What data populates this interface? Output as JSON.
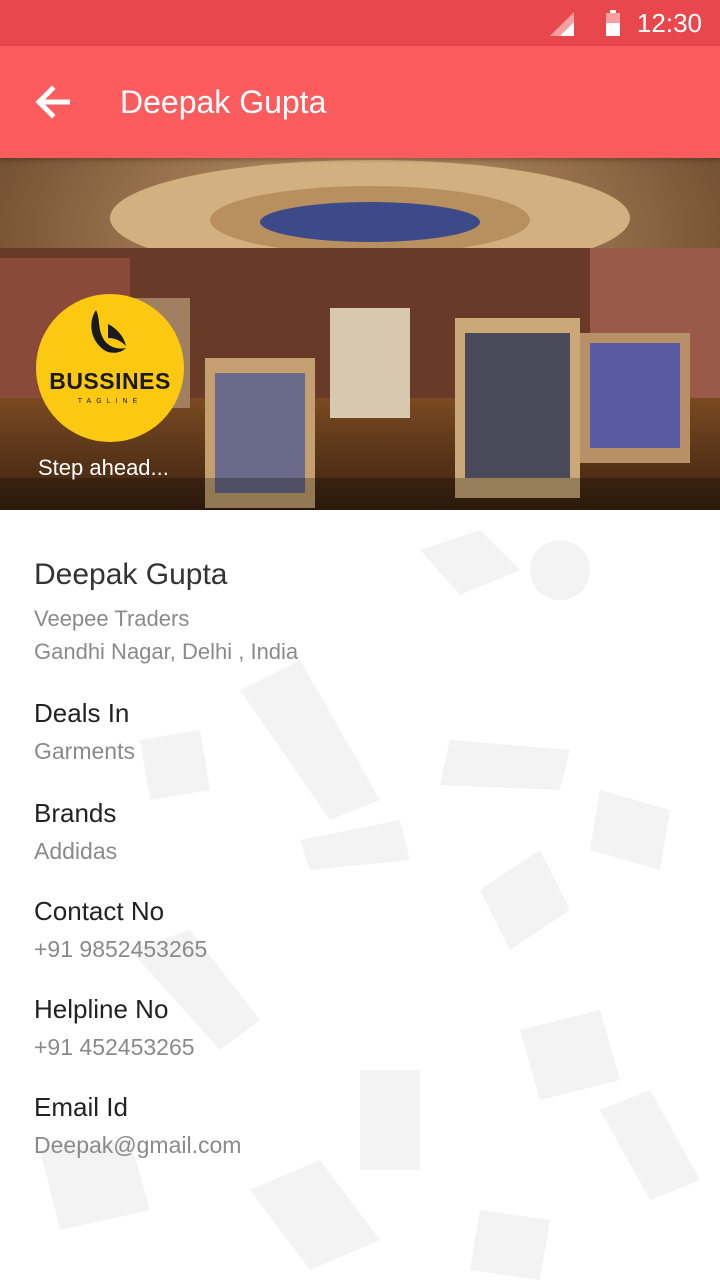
{
  "status_bar": {
    "time": "12:30",
    "signal_icon": "signal-icon",
    "battery_icon": "battery-icon"
  },
  "app_bar": {
    "title": "Deepak Gupta",
    "back_icon": "arrow-left-icon"
  },
  "hero": {
    "logo_text": "BUSSINES",
    "logo_tagline": "TAGLINE",
    "tagline": "Step ahead..."
  },
  "profile": {
    "name": "Deepak Gupta",
    "company": "Veepee Traders",
    "address": "Gandhi Nagar, Delhi , India",
    "fields": [
      {
        "label": "Deals In",
        "value": "Garments"
      },
      {
        "label": "Brands",
        "value": "Addidas"
      },
      {
        "label": "Contact No",
        "value": "+91 9852453265"
      },
      {
        "label": "Helpline No",
        "value": "+91 452453265"
      },
      {
        "label": "Email Id",
        "value": "Deepak@gmail.com"
      }
    ]
  },
  "colors": {
    "status_bar": "#e8474c",
    "app_bar": "#fd5c5e",
    "logo": "#fbc812"
  }
}
